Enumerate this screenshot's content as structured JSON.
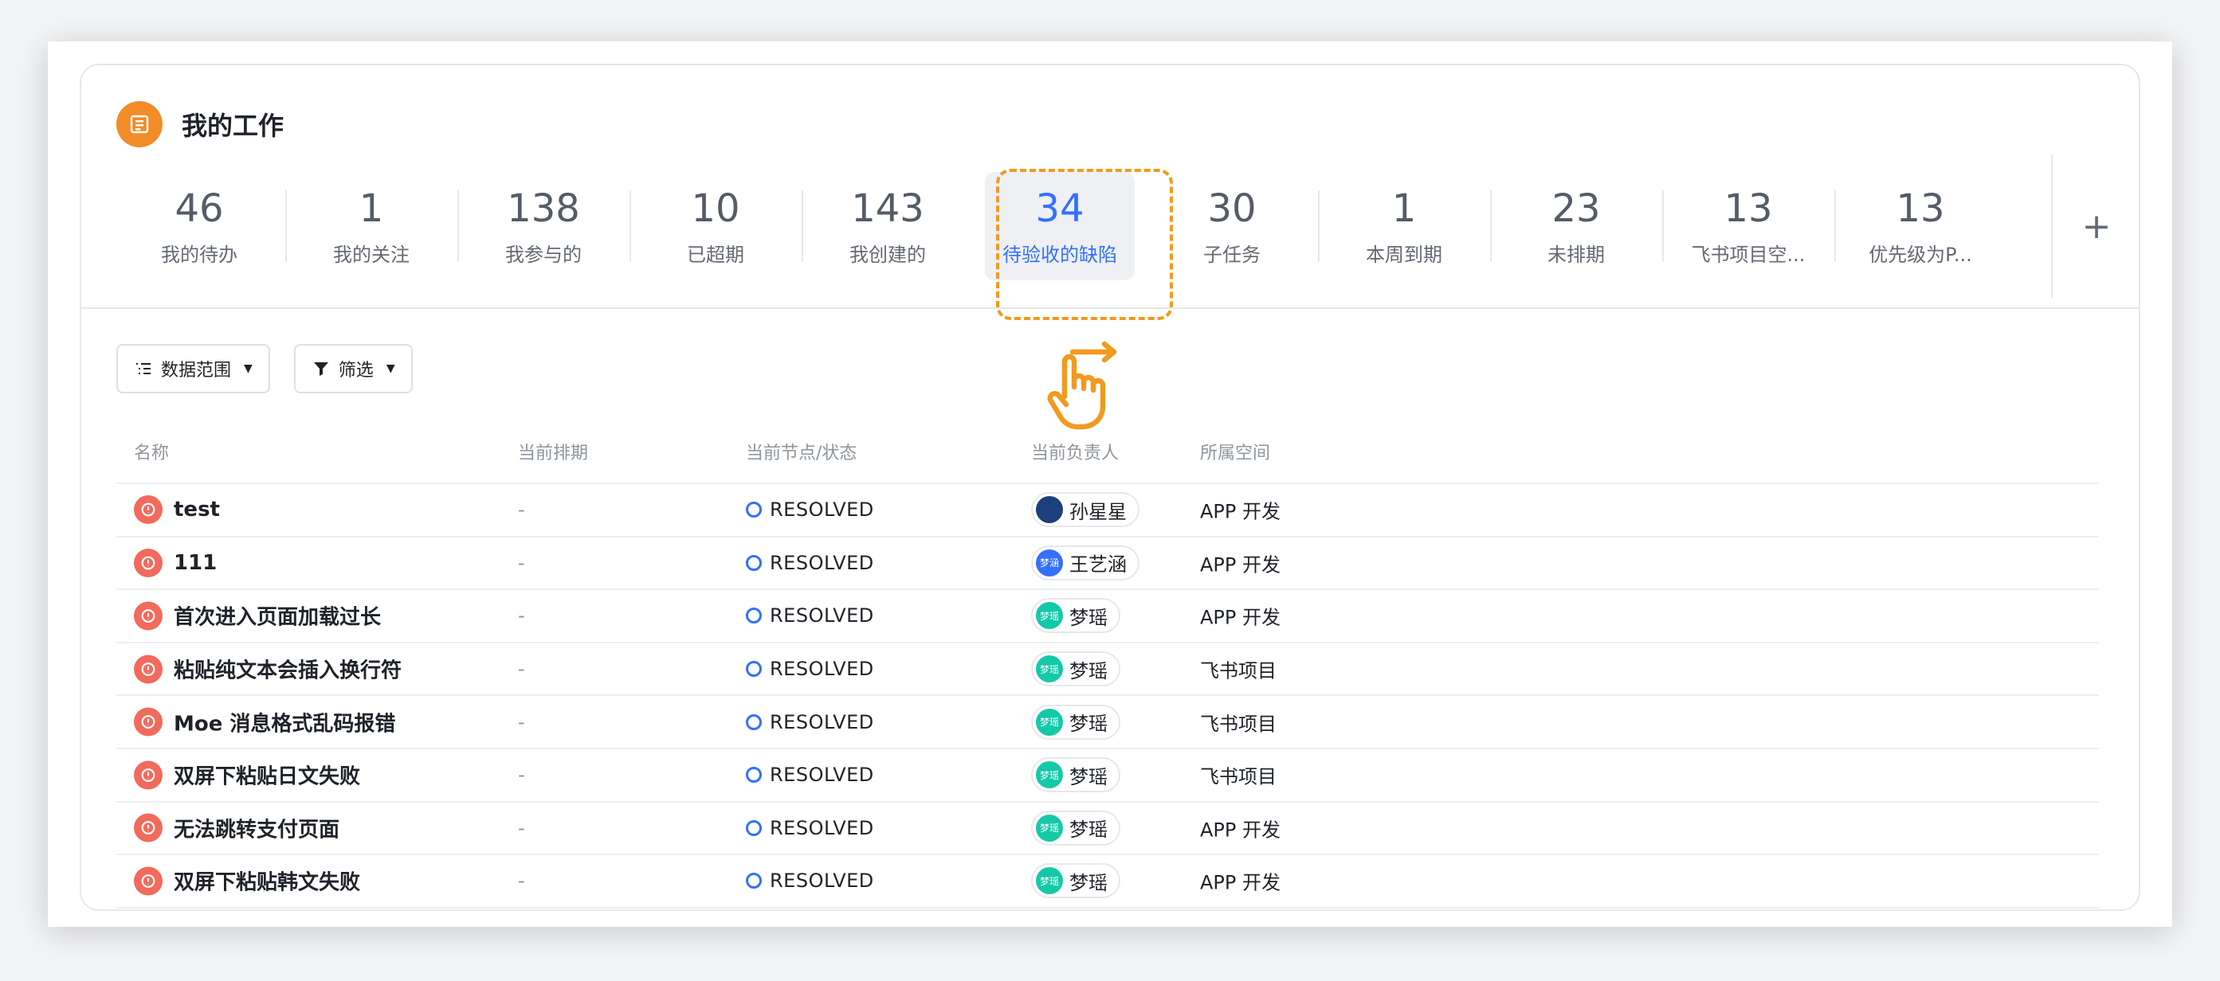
{
  "header": {
    "title": "我的工作",
    "icon": "list-icon",
    "icon_color": "#f28c28"
  },
  "stats": [
    {
      "num": "46",
      "label": "我的待办"
    },
    {
      "num": "1",
      "label": "我的关注"
    },
    {
      "num": "138",
      "label": "我参与的"
    },
    {
      "num": "10",
      "label": "已超期"
    },
    {
      "num": "143",
      "label": "我创建的"
    },
    {
      "num": "34",
      "label": "待验收的缺陷"
    },
    {
      "num": "30",
      "label": "子任务"
    },
    {
      "num": "1",
      "label": "本周到期"
    },
    {
      "num": "23",
      "label": "未排期"
    },
    {
      "num": "13",
      "label": "飞书项目空..."
    },
    {
      "num": "13",
      "label": "优先级为P..."
    }
  ],
  "active_stat_index": 5,
  "add_label": "+",
  "toolbar": {
    "scope_label": "数据范围",
    "filter_label": "筛选"
  },
  "table": {
    "headers": {
      "name": "名称",
      "schedule": "当前排期",
      "state": "当前节点/状态",
      "owner": "当前负责人",
      "space": "所属空间"
    },
    "rows": [
      {
        "name": "test",
        "schedule": "-",
        "state": "RESOLVED",
        "owner": "孙星星",
        "avatar_text": "",
        "avatar_color": "#1d3f7a",
        "space": "APP 开发"
      },
      {
        "name": "111",
        "schedule": "-",
        "state": "RESOLVED",
        "owner": "王艺涵",
        "avatar_text": "梦涵",
        "avatar_color": "#3370ff",
        "space": "APP 开发"
      },
      {
        "name": "首次进入页面加载过长",
        "schedule": "-",
        "state": "RESOLVED",
        "owner": "梦瑶",
        "avatar_text": "梦瑶",
        "avatar_color": "#14c9a8",
        "space": "APP 开发"
      },
      {
        "name": "粘贴纯文本会插入换行符",
        "schedule": "-",
        "state": "RESOLVED",
        "owner": "梦瑶",
        "avatar_text": "梦瑶",
        "avatar_color": "#14c9a8",
        "space": "飞书项目"
      },
      {
        "name": "Moe 消息格式乱码报错",
        "schedule": "-",
        "state": "RESOLVED",
        "owner": "梦瑶",
        "avatar_text": "梦瑶",
        "avatar_color": "#14c9a8",
        "space": "飞书项目"
      },
      {
        "name": "双屏下粘贴日文失败",
        "schedule": "-",
        "state": "RESOLVED",
        "owner": "梦瑶",
        "avatar_text": "梦瑶",
        "avatar_color": "#14c9a8",
        "space": "飞书项目"
      },
      {
        "name": "无法跳转支付页面",
        "schedule": "-",
        "state": "RESOLVED",
        "owner": "梦瑶",
        "avatar_text": "梦瑶",
        "avatar_color": "#14c9a8",
        "space": "APP 开发"
      },
      {
        "name": "双屏下粘贴韩文失败",
        "schedule": "-",
        "state": "RESOLVED",
        "owner": "梦瑶",
        "avatar_text": "梦瑶",
        "avatar_color": "#14c9a8",
        "space": "APP 开发"
      }
    ]
  },
  "colors": {
    "accent": "#3370ff",
    "highlight": "#f29a1e",
    "bug": "#f26a5c"
  }
}
